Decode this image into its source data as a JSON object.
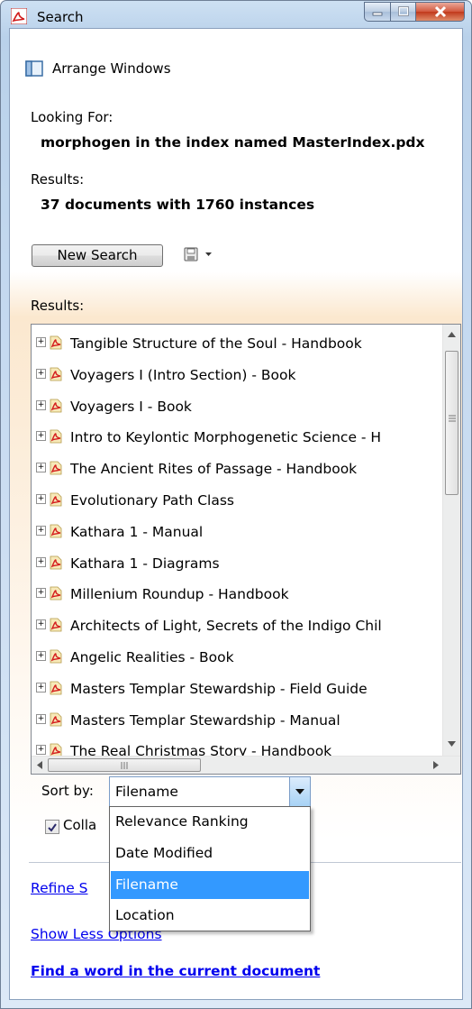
{
  "window": {
    "title": "Search",
    "app_icon": "acrobat-icon",
    "controls": [
      "minimize-icon",
      "maximize-icon",
      "close-icon"
    ]
  },
  "toolbar": {
    "arrange_label": "Arrange Windows",
    "arrange_icon": "window-layout-icon"
  },
  "search": {
    "looking_for_label": "Looking For:",
    "query_text": "morphogen in the index named MasterIndex.pdx",
    "results_label": "Results:",
    "results_summary": "37 documents with 1760 instances",
    "new_search_label": "New Search",
    "save_icon": "save-icon",
    "save_menu_icon": "dropdown-arrow-icon"
  },
  "results": {
    "label": "Results:",
    "items": [
      "Tangible Structure of the Soul - Handbook",
      "Voyagers I (Intro Section) - Book",
      "Voyagers I - Book",
      "Intro to Keylontic Morphogenetic Science - H",
      "The Ancient Rites of Passage - Handbook",
      "Evolutionary Path Class",
      "Kathara 1 - Manual",
      "Kathara 1 - Diagrams",
      "Millenium Roundup - Handbook",
      "Architects of Light, Secrets of the Indigo Chil",
      "Angelic Realities - Book",
      "Masters Templar Stewardship - Field Guide",
      "Masters Templar Stewardship - Manual",
      "The Real Christmas Story - Handbook"
    ]
  },
  "sort": {
    "label": "Sort by:",
    "selected": "Filename",
    "options": [
      "Relevance Ranking",
      "Date Modified",
      "Filename",
      "Location"
    ]
  },
  "collapse": {
    "label_visible": "Colla",
    "checked": true
  },
  "links": {
    "refine": "Refine S",
    "show_less": "Show Less Options",
    "find_word": "Find a word in the current document"
  },
  "colors": {
    "link": "#0000ee",
    "selection": "#3399ff",
    "title_gradient_top": "#cde0f3"
  }
}
